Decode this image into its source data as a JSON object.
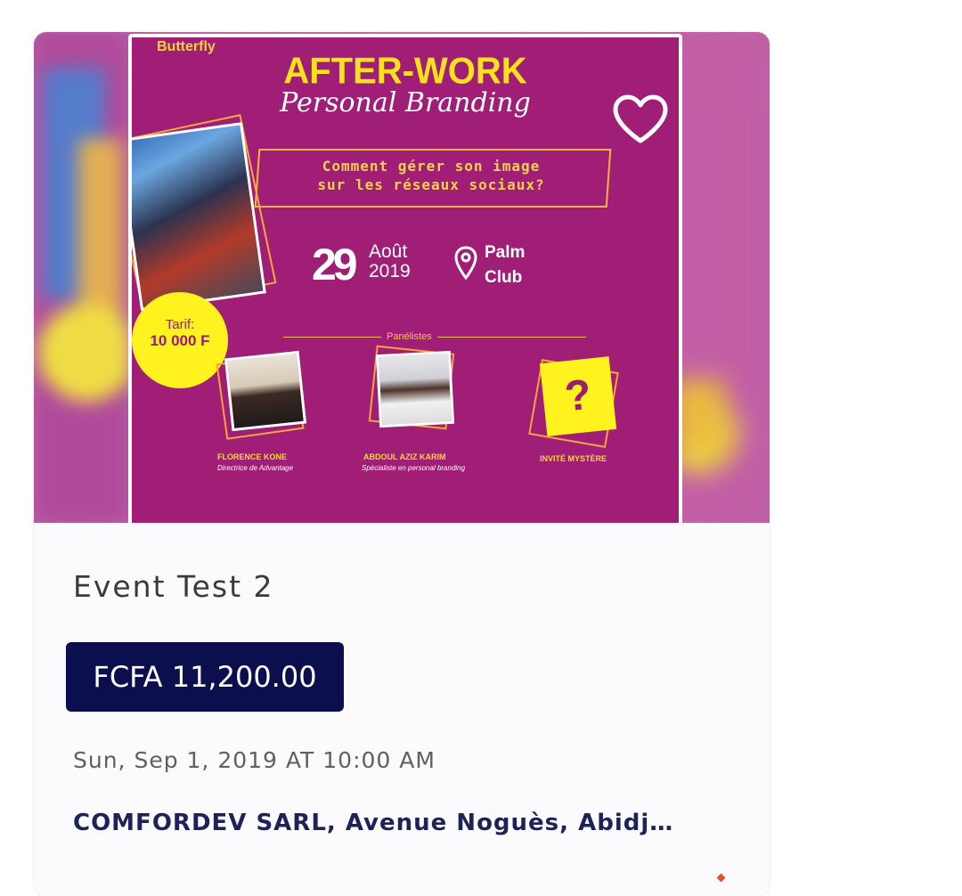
{
  "event_card": {
    "poster": {
      "brand": "Butterfly",
      "title": "AFTER-WORK",
      "subtitle": "Personal Branding",
      "question_line1": "Comment gérer son image",
      "question_line2": "sur les réseaux sociaux?",
      "date_day": "29",
      "date_month": "Août",
      "date_year": "2019",
      "place_line1": "Palm",
      "place_line2": "Club",
      "tarif_label": "Tarif:",
      "tarif_value": "10 000 F",
      "panel_title": "Panélistes",
      "panelists": [
        {
          "name": "FLORENCE KONE",
          "role": "Directrice de Advantage"
        },
        {
          "name": "ABDOUL AZIZ KARIM",
          "role": "Spécialiste en personal branding"
        },
        {
          "name": "INVITÉ MYSTÈRE",
          "role": ""
        }
      ],
      "mystery_symbol": "?"
    },
    "favorite_icon": "heart-outline-icon",
    "title": "Event Test 2",
    "price": "FCFA 11,200.00",
    "datetime": "Sun, Sep 1, 2019 AT 10:00 AM",
    "location": "COMFORDEV SARL, Avenue Noguès, Abidj…"
  },
  "colors": {
    "price_bg": "#0b0f4d",
    "location_text": "#1e2357",
    "poster_bg": "#a01e76",
    "poster_accent": "#f8e21d"
  }
}
